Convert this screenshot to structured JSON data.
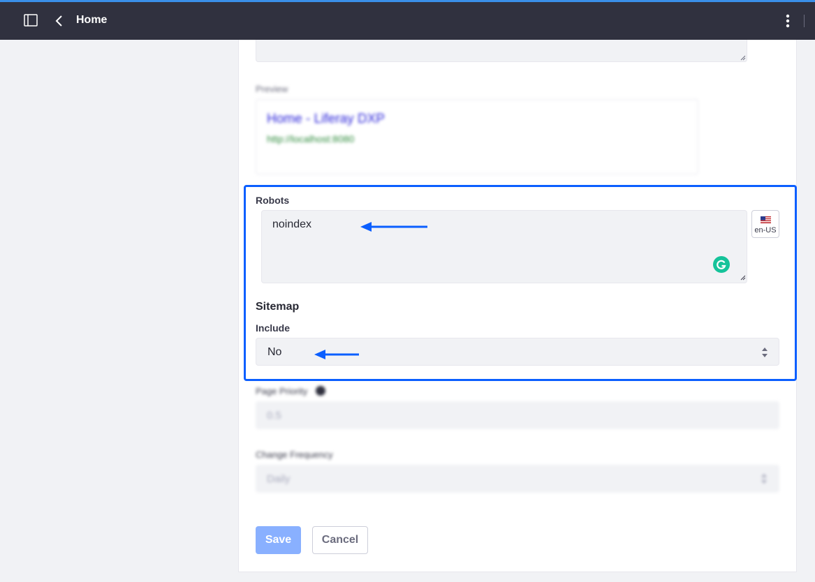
{
  "header": {
    "title": "Home",
    "icons": [
      "product-menu-icon",
      "back-icon",
      "options-kebab-icon"
    ]
  },
  "preview": {
    "label": "Preview",
    "title": "Home - Liferay DXP",
    "url": "http://localhost:8080"
  },
  "robots": {
    "label": "Robots",
    "value": "noindex",
    "language": "en-US"
  },
  "sitemap": {
    "heading": "Sitemap",
    "include_label": "Include",
    "include_value": "No",
    "page_priority_label": "Page Priority",
    "page_priority_value": "0.5",
    "change_frequency_label": "Change Frequency",
    "change_frequency_value": "Daily"
  },
  "actions": {
    "save_label": "Save",
    "cancel_label": "Cancel"
  },
  "colors": {
    "highlight": "#0b5fff",
    "header_bg": "#30313f",
    "save_bg": "#89b0ff"
  }
}
